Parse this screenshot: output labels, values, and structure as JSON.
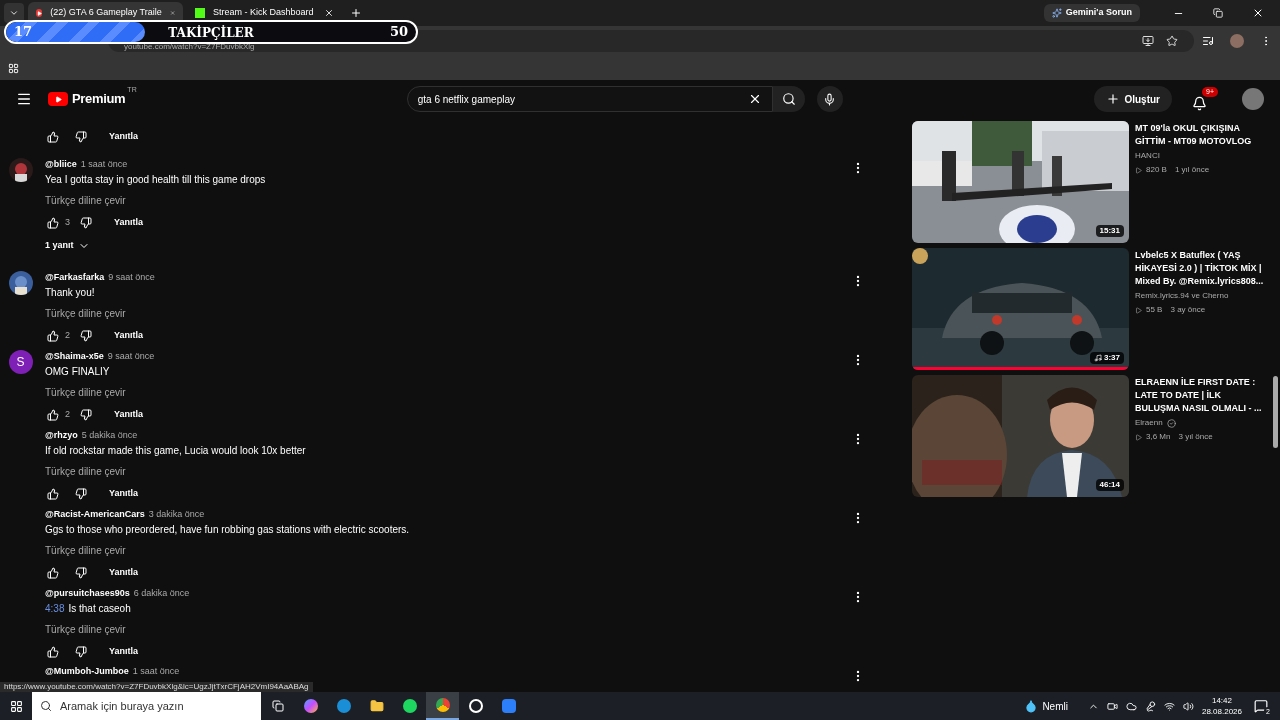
{
  "browser": {
    "tabs": [
      {
        "title": "(22) GTA 6 Gameplay Traile",
        "kind": "youtube",
        "selected": true
      },
      {
        "title": "Stream - Kick Dashboard",
        "kind": "kick",
        "selected": false
      }
    ],
    "gemini_button": "Gemini'a Sorun",
    "url": "youtube.com/watch?v=Z7FDuvbkXlg"
  },
  "follower_goal": {
    "current": "17",
    "label": "TAKİPÇİLER",
    "goal": "50",
    "level": 0.34
  },
  "header": {
    "logo": "Premium",
    "region": "TR",
    "search_value": "gta 6 netflix gameplay",
    "create_button": "Oluştur",
    "notification_count": "9+"
  },
  "comments": [
    {
      "kind": "tail",
      "reply_label": "Yanıtla"
    },
    {
      "kind": "comment",
      "handle": "@bliice",
      "time": "1 saat önce",
      "text": "Yea I gotta stay in good health till this game drops",
      "translate": "Türkçe diline çevir",
      "likes": "3",
      "reply_label": "Yanıtla",
      "replies_toggle": "1 yanıt"
    },
    {
      "kind": "comment",
      "handle": "@Farkasfarka",
      "time": "9 saat önce",
      "text": "Thank you!",
      "translate": "Türkçe diline çevir",
      "likes": "2",
      "reply_label": "Yanıtla"
    },
    {
      "kind": "comment",
      "avatar": {
        "kind": "letter",
        "letter": "S"
      },
      "handle": "@Shaima-x5e",
      "time": "9 saat önce",
      "text": "OMG FINALIY",
      "translate": "Türkçe diline çevir",
      "likes": "2",
      "reply_label": "Yanıtla"
    },
    {
      "kind": "comment",
      "handle": "@rhzyo",
      "time": "5 dakika önce",
      "text": "If old rockstar made this game, Lucia would look 10x better",
      "translate": "Türkçe diline çevir",
      "reply_label": "Yanıtla"
    },
    {
      "kind": "comment",
      "handle": "@Racist-AmericanCars",
      "time": "3 dakika önce",
      "text": "Ggs to those who preordered, have fun robbing gas stations with electric scooters.",
      "translate": "Türkçe diline çevir",
      "reply_label": "Yanıtla"
    },
    {
      "kind": "comment",
      "handle": "@pursuitchases90s",
      "time": "6 dakika önce",
      "timestamp_link": "4:38",
      "text": "Is that caseoh",
      "translate": "Türkçe diline çevir",
      "reply_label": "Yanıtla"
    },
    {
      "kind": "header_only",
      "handle": "@Mumboh-Jumboe",
      "time": "1 saat önce"
    }
  ],
  "recommended": [
    {
      "title": "MT 09'la OKUL ÇIKIŞINA GİTTİM - MT09 MOTOVLOG",
      "channel": "HANCI",
      "verified": false,
      "views": "820 B",
      "age": "1 yıl önce",
      "duration": "15:31",
      "music": false
    },
    {
      "title": "Lvbelc5 X Batuflex ( YAŞ HİKAYESİ 2.0 ) | TİKTOK MİX | Mixed By. @Remix.lyrics808...",
      "channel": "Remix.lyrics.94 ve Cherno",
      "verified": false,
      "views": "55 B",
      "age": "3 ay önce",
      "duration": "3:37",
      "music": true,
      "level": 1
    },
    {
      "title": "ELRAENN İLE FIRST DATE : LATE TO DATE | İLK BULUŞMA NASIL OLMALI - ...",
      "channel": "Elraenn",
      "verified": true,
      "views": "3,6 Mn",
      "age": "3 yıl önce",
      "duration": "46:14",
      "music": false
    }
  ],
  "status_url": "https://www.youtube.com/watch?v=Z7FDuvbkXlg&lc=UgzJjtTxrCFjAH2VmI94AaABAg",
  "taskbar": {
    "search_placeholder": "Aramak için buraya yazın",
    "weather": "Nemli",
    "time": "14:42",
    "date": "28.08.2026",
    "notifications": "2"
  }
}
